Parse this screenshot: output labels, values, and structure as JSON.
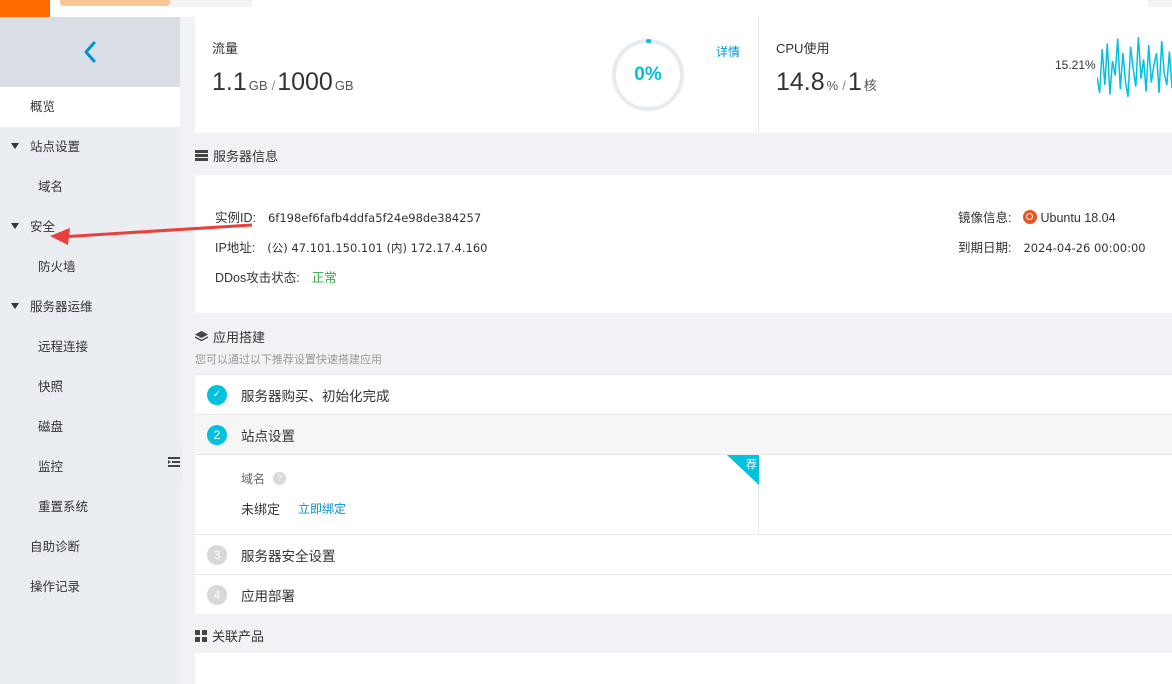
{
  "colors": {
    "accent": "#00c1de",
    "brand": "#ff6a00",
    "link": "#0093d0",
    "ok": "#2fab45",
    "arrow": "#e8403a"
  },
  "sidebar": {
    "back_icon": "chevron-left-icon",
    "items": [
      {
        "label": "概览"
      },
      {
        "label": "站点设置"
      },
      {
        "label": "域名"
      },
      {
        "label": "安全"
      },
      {
        "label": "防火墙"
      },
      {
        "label": "服务器运维"
      },
      {
        "label": "远程连接"
      },
      {
        "label": "快照"
      },
      {
        "label": "磁盘"
      },
      {
        "label": "监控"
      },
      {
        "label": "重置系统"
      },
      {
        "label": "自助诊断"
      },
      {
        "label": "操作记录"
      }
    ]
  },
  "traffic": {
    "label": "流量",
    "used": "1.1",
    "used_unit": "GB",
    "separator": "/",
    "total": "1000",
    "total_unit": "GB",
    "percent_text": "0%",
    "percent": 0,
    "details_link": "详情"
  },
  "cpu": {
    "label": "CPU使用",
    "usage": "14.8",
    "usage_unit": "%",
    "separator": "/",
    "cores": "1",
    "cores_unit": "核",
    "current_pct": "15.21%",
    "spark": [
      40,
      20,
      75,
      30,
      82,
      18,
      60,
      42,
      88,
      25,
      70,
      35,
      15,
      78,
      50,
      28,
      90,
      38,
      62,
      22,
      80,
      33,
      55,
      70,
      20,
      85,
      45,
      30,
      72,
      26
    ]
  },
  "server_info": {
    "title": "服务器信息",
    "instance_id_label": "实例ID:",
    "instance_id": "6f198ef6fafb4ddfa5f24e98de384257",
    "ip_label": "IP地址:",
    "ip": "(公) 47.101.150.101 (内) 172.17.4.160",
    "ddos_label": "DDos攻击状态:",
    "ddos": "正常",
    "image_label": "镜像信息:",
    "image": "Ubuntu 18.04",
    "expire_label": "到期日期:",
    "expire": "2024-04-26 00:00:00"
  },
  "app_setup": {
    "title": "应用搭建",
    "subtitle": "您可以通过以下推荐设置快速搭建应用",
    "steps": [
      {
        "num": "✓",
        "label": "服务器购买、初始化完成"
      },
      {
        "num": "2",
        "label": "站点设置"
      },
      {
        "num": "3",
        "label": "服务器安全设置"
      },
      {
        "num": "4",
        "label": "应用部署"
      }
    ],
    "domain_label": "域名",
    "help_icon": "?",
    "domain_status": "未绑定",
    "bind_link": "立即绑定",
    "recommend_badge": "荐"
  },
  "related": {
    "title": "关联产品"
  }
}
